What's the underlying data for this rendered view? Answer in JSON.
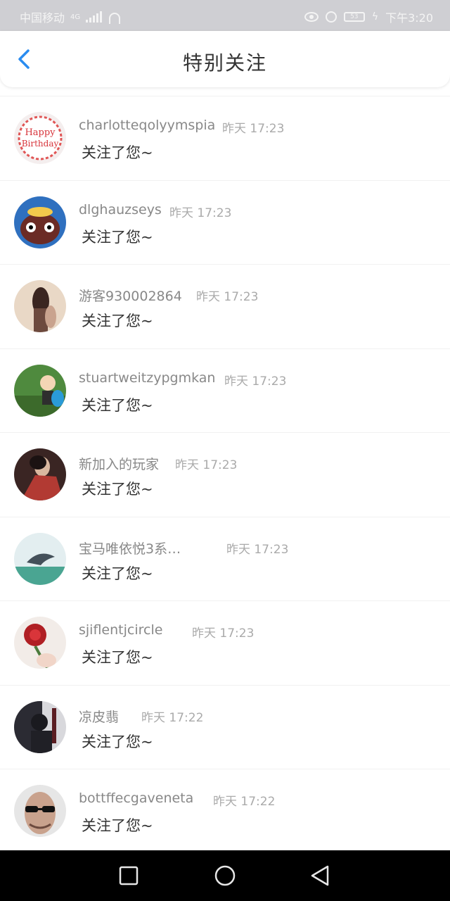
{
  "status_bar": {
    "carrier": "中国移动",
    "network": "4G",
    "battery": "53",
    "time": "下午3:20",
    "icons": [
      "signal-icon",
      "wifi-icon",
      "eye-icon",
      "alarm-icon",
      "battery-icon",
      "charging-icon"
    ]
  },
  "header": {
    "title": "特别关注",
    "back_icon": "chevron-left-icon",
    "accent": "#2a8cf0"
  },
  "list": {
    "items": [
      {
        "name": "charlotteqolyymspia",
        "time": "昨天 17:23",
        "message": "关注了您~"
      },
      {
        "name": "dlghauzseys",
        "time": "昨天 17:23",
        "message": "关注了您~"
      },
      {
        "name": "游客930002864",
        "time": "昨天 17:23",
        "message": "关注了您~"
      },
      {
        "name": "stuartweitzypgmkan",
        "time": "昨天 17:23",
        "message": "关注了您~"
      },
      {
        "name": "新加入的玩家",
        "time": "昨天 17:23",
        "message": "关注了您~"
      },
      {
        "name": "宝马唯依悦3系…",
        "time": "昨天 17:23",
        "message": "关注了您~"
      },
      {
        "name": "sjiflentjcircle",
        "time": "昨天 17:23",
        "message": "关注了您~"
      },
      {
        "name": "凉皮翡",
        "time": "昨天 17:22",
        "message": "关注了您~"
      },
      {
        "name": "bottffecgaveneta",
        "time": "昨天 17:22",
        "message": "关注了您~"
      }
    ]
  },
  "nav_bar": {
    "buttons": [
      "recent-apps-icon",
      "home-icon",
      "back-triangle-icon"
    ]
  }
}
